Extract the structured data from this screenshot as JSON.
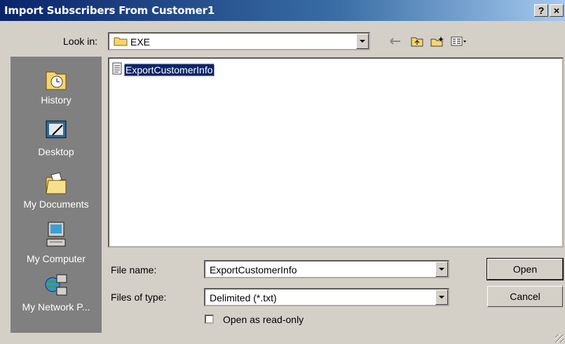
{
  "window": {
    "title": "Import Subscribers From Customer1",
    "help_label": "?",
    "close_label": "×"
  },
  "look_in": {
    "label": "Look in:",
    "value": "EXE"
  },
  "toolbar": {
    "back_icon": "back-arrow-icon",
    "up_icon": "up-folder-icon",
    "new_folder_icon": "new-folder-icon",
    "views_icon": "views-menu-icon"
  },
  "places": [
    {
      "label": "History",
      "icon": "history-icon"
    },
    {
      "label": "Desktop",
      "icon": "desktop-icon"
    },
    {
      "label": "My Documents",
      "icon": "my-documents-icon"
    },
    {
      "label": "My Computer",
      "icon": "my-computer-icon"
    },
    {
      "label": "My Network P...",
      "icon": "my-network-places-icon"
    }
  ],
  "files": [
    {
      "name": "ExportCustomerInfo",
      "icon": "text-file-icon",
      "selected": true
    }
  ],
  "file_name": {
    "label": "File name:",
    "value": "ExportCustomerInfo"
  },
  "file_type": {
    "label": "Files of type:",
    "value": "Delimited (*.txt)"
  },
  "read_only": {
    "label": "Open as read-only",
    "checked": false
  },
  "buttons": {
    "open": "Open",
    "cancel": "Cancel"
  },
  "colors": {
    "title_bar": "#0a246a",
    "selection": "#0a246a",
    "places_bar": "#808080",
    "dialog_face": "#d4d0c8"
  }
}
